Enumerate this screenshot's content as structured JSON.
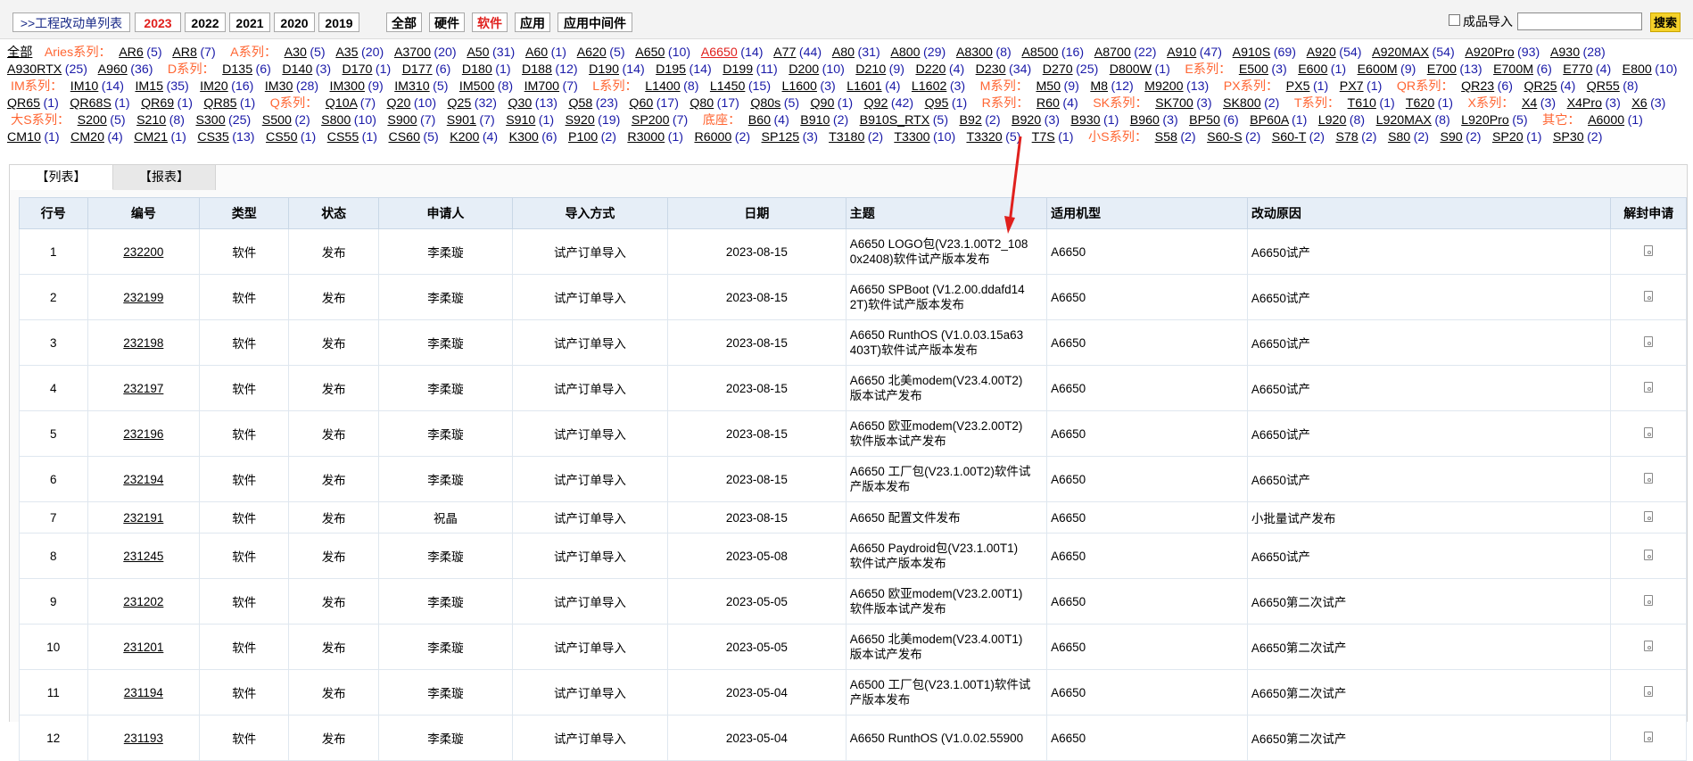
{
  "toolbar": {
    "title": ">>工程改动单列表",
    "years": [
      "2023",
      "2022",
      "2021",
      "2020",
      "2019"
    ],
    "filters": [
      "全部",
      "硬件",
      "软件",
      "应用",
      "应用中间件"
    ],
    "product_import_label": "成品导入",
    "search_placeholder": "",
    "search_label": "搜索"
  },
  "models": {
    "all_label": "全部",
    "groups": [
      {
        "cat": "Aries系列：",
        "items": [
          [
            "AR6",
            "(5)"
          ],
          [
            "AR8",
            "(7)"
          ]
        ]
      },
      {
        "cat": "A系列：",
        "items": [
          [
            "A30",
            "(5)"
          ],
          [
            "A35",
            "(20)"
          ],
          [
            "A3700",
            "(20)"
          ],
          [
            "A50",
            "(31)"
          ],
          [
            "A60",
            "(1)"
          ],
          [
            "A620",
            "(5)"
          ],
          [
            "A650",
            "(10)"
          ],
          [
            "A6650",
            "(14)"
          ],
          [
            "A77",
            "(44)"
          ],
          [
            "A80",
            "(31)"
          ],
          [
            "A800",
            "(29)"
          ],
          [
            "A8300",
            "(8)"
          ],
          [
            "A8500",
            "(16)"
          ],
          [
            "A8700",
            "(22)"
          ],
          [
            "A910",
            "(47)"
          ],
          [
            "A910S",
            "(69)"
          ],
          [
            "A920",
            "(54)"
          ],
          [
            "A920MAX",
            "(54)"
          ],
          [
            "A920Pro",
            "(93)"
          ],
          [
            "A930",
            "(28)"
          ],
          [
            "A930RTX",
            "(25)"
          ],
          [
            "A960",
            "(36)"
          ]
        ]
      },
      {
        "cat": "D系列：",
        "items": [
          [
            "D135",
            "(6)"
          ],
          [
            "D140",
            "(3)"
          ],
          [
            "D170",
            "(1)"
          ],
          [
            "D177",
            "(6)"
          ],
          [
            "D180",
            "(1)"
          ],
          [
            "D188",
            "(12)"
          ],
          [
            "D190",
            "(14)"
          ],
          [
            "D195",
            "(14)"
          ],
          [
            "D199",
            "(11)"
          ],
          [
            "D200",
            "(10)"
          ],
          [
            "D210",
            "(9)"
          ],
          [
            "D220",
            "(4)"
          ],
          [
            "D230",
            "(34)"
          ],
          [
            "D270",
            "(25)"
          ],
          [
            "D800W",
            "(1)"
          ]
        ]
      },
      {
        "cat": "E系列：",
        "items": [
          [
            "E500",
            "(3)"
          ],
          [
            "E600",
            "(1)"
          ],
          [
            "E600M",
            "(9)"
          ],
          [
            "E700",
            "(13)"
          ],
          [
            "E700M",
            "(6)"
          ],
          [
            "E770",
            "(4)"
          ],
          [
            "E800",
            "(10)"
          ]
        ]
      },
      {
        "cat": "IM系列：",
        "items": [
          [
            "IM10",
            "(14)"
          ],
          [
            "IM15",
            "(35)"
          ],
          [
            "IM20",
            "(16)"
          ],
          [
            "IM30",
            "(28)"
          ],
          [
            "IM300",
            "(9)"
          ],
          [
            "IM310",
            "(5)"
          ],
          [
            "IM500",
            "(8)"
          ],
          [
            "IM700",
            "(7)"
          ]
        ]
      },
      {
        "cat": "L系列：",
        "items": [
          [
            "L1400",
            "(8)"
          ],
          [
            "L1450",
            "(15)"
          ],
          [
            "L1600",
            "(3)"
          ],
          [
            "L1601",
            "(4)"
          ],
          [
            "L1602",
            "(3)"
          ]
        ]
      },
      {
        "cat": "M系列：",
        "items": [
          [
            "M50",
            "(9)"
          ],
          [
            "M8",
            "(12)"
          ],
          [
            "M9200",
            "(13)"
          ]
        ]
      },
      {
        "cat": "PX系列：",
        "items": [
          [
            "PX5",
            "(1)"
          ],
          [
            "PX7",
            "(1)"
          ]
        ]
      },
      {
        "cat": "QR系列：",
        "items": [
          [
            "QR23",
            "(6)"
          ],
          [
            "QR25",
            "(4)"
          ],
          [
            "QR55",
            "(8)"
          ],
          [
            "QR65",
            "(1)"
          ],
          [
            "QR68S",
            "(1)"
          ],
          [
            "QR69",
            "(1)"
          ],
          [
            "QR85",
            "(1)"
          ]
        ]
      },
      {
        "cat": "Q系列：",
        "items": [
          [
            "Q10A",
            "(7)"
          ],
          [
            "Q20",
            "(10)"
          ],
          [
            "Q25",
            "(32)"
          ],
          [
            "Q30",
            "(13)"
          ],
          [
            "Q58",
            "(23)"
          ],
          [
            "Q60",
            "(17)"
          ],
          [
            "Q80",
            "(17)"
          ],
          [
            "Q80s",
            "(5)"
          ],
          [
            "Q90",
            "(1)"
          ],
          [
            "Q92",
            "(42)"
          ],
          [
            "Q95",
            "(1)"
          ]
        ]
      },
      {
        "cat": "R系列：",
        "items": [
          [
            "R60",
            "(4)"
          ]
        ]
      },
      {
        "cat": "SK系列：",
        "items": [
          [
            "SK700",
            "(3)"
          ],
          [
            "SK800",
            "(2)"
          ]
        ]
      },
      {
        "cat": "T系列：",
        "items": [
          [
            "T610",
            "(1)"
          ],
          [
            "T620",
            "(1)"
          ]
        ]
      },
      {
        "cat": "X系列：",
        "items": [
          [
            "X4",
            "(3)"
          ],
          [
            "X4Pro",
            "(3)"
          ],
          [
            "X6",
            "(3)"
          ]
        ]
      },
      {
        "cat": "大S系列：",
        "items": [
          [
            "S200",
            "(5)"
          ],
          [
            "S210",
            "(8)"
          ],
          [
            "S300",
            "(25)"
          ],
          [
            "S500",
            "(2)"
          ],
          [
            "S800",
            "(10)"
          ],
          [
            "S900",
            "(7)"
          ],
          [
            "S901",
            "(7)"
          ],
          [
            "S910",
            "(1)"
          ],
          [
            "S920",
            "(19)"
          ],
          [
            "SP200",
            "(7)"
          ]
        ]
      },
      {
        "cat": "底座：",
        "items": [
          [
            "B60",
            "(4)"
          ],
          [
            "B910",
            "(2)"
          ],
          [
            "B910S_RTX",
            "(5)"
          ],
          [
            "B92",
            "(2)"
          ],
          [
            "B920",
            "(3)"
          ],
          [
            "B930",
            "(1)"
          ],
          [
            "B960",
            "(3)"
          ],
          [
            "BP50",
            "(6)"
          ],
          [
            "BP60A",
            "(1)"
          ],
          [
            "L920",
            "(8)"
          ],
          [
            "L920MAX",
            "(8)"
          ],
          [
            "L920Pro",
            "(5)"
          ]
        ]
      },
      {
        "cat": "其它：",
        "items": [
          [
            "A6000",
            "(1)"
          ],
          [
            "CM10",
            "(1)"
          ],
          [
            "CM20",
            "(4)"
          ],
          [
            "CM21",
            "(1)"
          ],
          [
            "CS35",
            "(13)"
          ],
          [
            "CS50",
            "(1)"
          ],
          [
            "CS55",
            "(1)"
          ],
          [
            "CS60",
            "(5)"
          ],
          [
            "K200",
            "(4)"
          ],
          [
            "K300",
            "(6)"
          ],
          [
            "P100",
            "(2)"
          ],
          [
            "R3000",
            "(1)"
          ],
          [
            "R6000",
            "(2)"
          ],
          [
            "SP125",
            "(3)"
          ],
          [
            "T3180",
            "(2)"
          ],
          [
            "T3300",
            "(10)"
          ],
          [
            "T3320",
            "(5)"
          ],
          [
            "T7S",
            "(1)"
          ]
        ]
      },
      {
        "cat": "小S系列：",
        "items": [
          [
            "S58",
            "(2)"
          ],
          [
            "S60-S",
            "(2)"
          ],
          [
            "S60-T",
            "(2)"
          ],
          [
            "S78",
            "(2)"
          ],
          [
            "S80",
            "(2)"
          ],
          [
            "S90",
            "(2)"
          ],
          [
            "SP20",
            "(1)"
          ],
          [
            "SP30",
            "(2)"
          ]
        ]
      }
    ],
    "selected": "A6650"
  },
  "tabs": [
    "【列表】",
    "【报表】"
  ],
  "table": {
    "headers": [
      "行号",
      "编号",
      "类型",
      "状态",
      "申请人",
      "导入方式",
      "日期",
      "主题",
      "适用机型",
      "改动原因",
      "解封申请"
    ],
    "rows": [
      {
        "no": "1",
        "id": "232200",
        "type": "软件",
        "status": "发布",
        "applicant": "李柔璇",
        "import": "试产订单导入",
        "date": "2023-08-15",
        "subject": [
          "A6650 LOGO包(V23.1.00T2_108",
          "0x2408)软件试产版本发布"
        ],
        "model": "A6650",
        "reason": "A6650试产"
      },
      {
        "no": "2",
        "id": "232199",
        "type": "软件",
        "status": "发布",
        "applicant": "李柔璇",
        "import": "试产订单导入",
        "date": "2023-08-15",
        "subject": [
          "A6650 SPBoot (V1.2.00.ddafd14",
          "2T)软件试产版本发布"
        ],
        "model": "A6650",
        "reason": "A6650试产"
      },
      {
        "no": "3",
        "id": "232198",
        "type": "软件",
        "status": "发布",
        "applicant": "李柔璇",
        "import": "试产订单导入",
        "date": "2023-08-15",
        "subject": [
          "A6650 RunthOS (V1.0.03.15a63",
          "403T)软件试产版本发布"
        ],
        "model": "A6650",
        "reason": "A6650试产"
      },
      {
        "no": "4",
        "id": "232197",
        "type": "软件",
        "status": "发布",
        "applicant": "李柔璇",
        "import": "试产订单导入",
        "date": "2023-08-15",
        "subject": [
          "A6650 北美modem(V23.4.00T2)",
          "版本试产发布"
        ],
        "model": "A6650",
        "reason": "A6650试产"
      },
      {
        "no": "5",
        "id": "232196",
        "type": "软件",
        "status": "发布",
        "applicant": "李柔璇",
        "import": "试产订单导入",
        "date": "2023-08-15",
        "subject": [
          "A6650 欧亚modem(V23.2.00T2)",
          "软件版本试产发布"
        ],
        "model": "A6650",
        "reason": "A6650试产"
      },
      {
        "no": "6",
        "id": "232194",
        "type": "软件",
        "status": "发布",
        "applicant": "李柔璇",
        "import": "试产订单导入",
        "date": "2023-08-15",
        "subject": [
          "A6650 工厂包(V23.1.00T2)软件试",
          "产版本发布"
        ],
        "model": "A6650",
        "reason": "A6650试产"
      },
      {
        "no": "7",
        "id": "232191",
        "type": "软件",
        "status": "发布",
        "applicant": "祝晶",
        "import": "试产订单导入",
        "date": "2023-08-15",
        "subject": [
          "A6650 配置文件发布"
        ],
        "model": "A6650",
        "reason": "小批量试产发布"
      },
      {
        "no": "8",
        "id": "231245",
        "type": "软件",
        "status": "发布",
        "applicant": "李柔璇",
        "import": "试产订单导入",
        "date": "2023-05-08",
        "subject": [
          "A6650 Paydroid包(V23.1.00T1)",
          "软件试产版本发布"
        ],
        "model": "A6650",
        "reason": "A6650试产"
      },
      {
        "no": "9",
        "id": "231202",
        "type": "软件",
        "status": "发布",
        "applicant": "李柔璇",
        "import": "试产订单导入",
        "date": "2023-05-05",
        "subject": [
          "A6650 欧亚modem(V23.2.00T1)",
          "软件版本试产发布"
        ],
        "model": "A6650",
        "reason": "A6650第二次试产"
      },
      {
        "no": "10",
        "id": "231201",
        "type": "软件",
        "status": "发布",
        "applicant": "李柔璇",
        "import": "试产订单导入",
        "date": "2023-05-05",
        "subject": [
          "A6650 北美modem(V23.4.00T1)",
          "版本试产发布"
        ],
        "model": "A6650",
        "reason": "A6650第二次试产"
      },
      {
        "no": "11",
        "id": "231194",
        "type": "软件",
        "status": "发布",
        "applicant": "李柔璇",
        "import": "试产订单导入",
        "date": "2023-05-04",
        "subject": [
          "A6500 工厂包(V23.1.00T1)软件试",
          "产版本发布"
        ],
        "model": "A6650",
        "reason": "A6650第二次试产"
      },
      {
        "no": "12",
        "id": "231193",
        "type": "软件",
        "status": "发布",
        "applicant": "李柔璇",
        "import": "试产订单导入",
        "date": "2023-05-04",
        "subject": [
          "A6650 RunthOS (V1.0.02.55900",
          ""
        ],
        "model": "A6650",
        "reason": "A6650第二次试产"
      }
    ]
  },
  "colors": {
    "accent_red": "#e0201d",
    "category_orange": "#ff6633",
    "count_blue": "#1a1aa8",
    "search_yellow": "#f5d22a",
    "header_bg": "#e6eef7"
  }
}
